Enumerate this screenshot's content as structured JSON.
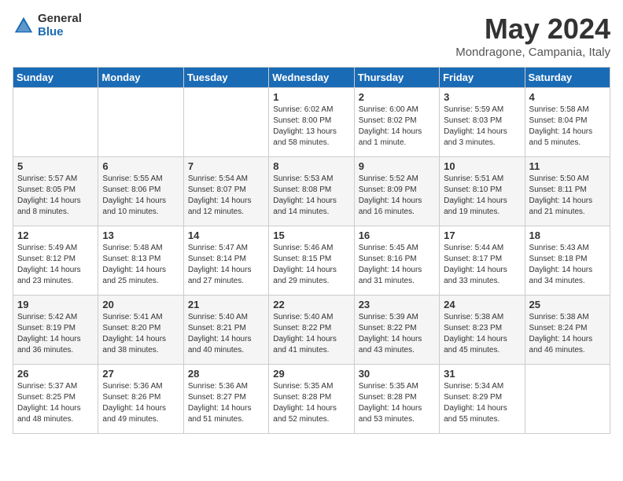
{
  "logo": {
    "general": "General",
    "blue": "Blue"
  },
  "title": "May 2024",
  "subtitle": "Mondragone, Campania, Italy",
  "days_of_week": [
    "Sunday",
    "Monday",
    "Tuesday",
    "Wednesday",
    "Thursday",
    "Friday",
    "Saturday"
  ],
  "weeks": [
    [
      {
        "day": "",
        "info": ""
      },
      {
        "day": "",
        "info": ""
      },
      {
        "day": "",
        "info": ""
      },
      {
        "day": "1",
        "info": "Sunrise: 6:02 AM\nSunset: 8:00 PM\nDaylight: 13 hours\nand 58 minutes."
      },
      {
        "day": "2",
        "info": "Sunrise: 6:00 AM\nSunset: 8:02 PM\nDaylight: 14 hours\nand 1 minute."
      },
      {
        "day": "3",
        "info": "Sunrise: 5:59 AM\nSunset: 8:03 PM\nDaylight: 14 hours\nand 3 minutes."
      },
      {
        "day": "4",
        "info": "Sunrise: 5:58 AM\nSunset: 8:04 PM\nDaylight: 14 hours\nand 5 minutes."
      }
    ],
    [
      {
        "day": "5",
        "info": "Sunrise: 5:57 AM\nSunset: 8:05 PM\nDaylight: 14 hours\nand 8 minutes."
      },
      {
        "day": "6",
        "info": "Sunrise: 5:55 AM\nSunset: 8:06 PM\nDaylight: 14 hours\nand 10 minutes."
      },
      {
        "day": "7",
        "info": "Sunrise: 5:54 AM\nSunset: 8:07 PM\nDaylight: 14 hours\nand 12 minutes."
      },
      {
        "day": "8",
        "info": "Sunrise: 5:53 AM\nSunset: 8:08 PM\nDaylight: 14 hours\nand 14 minutes."
      },
      {
        "day": "9",
        "info": "Sunrise: 5:52 AM\nSunset: 8:09 PM\nDaylight: 14 hours\nand 16 minutes."
      },
      {
        "day": "10",
        "info": "Sunrise: 5:51 AM\nSunset: 8:10 PM\nDaylight: 14 hours\nand 19 minutes."
      },
      {
        "day": "11",
        "info": "Sunrise: 5:50 AM\nSunset: 8:11 PM\nDaylight: 14 hours\nand 21 minutes."
      }
    ],
    [
      {
        "day": "12",
        "info": "Sunrise: 5:49 AM\nSunset: 8:12 PM\nDaylight: 14 hours\nand 23 minutes."
      },
      {
        "day": "13",
        "info": "Sunrise: 5:48 AM\nSunset: 8:13 PM\nDaylight: 14 hours\nand 25 minutes."
      },
      {
        "day": "14",
        "info": "Sunrise: 5:47 AM\nSunset: 8:14 PM\nDaylight: 14 hours\nand 27 minutes."
      },
      {
        "day": "15",
        "info": "Sunrise: 5:46 AM\nSunset: 8:15 PM\nDaylight: 14 hours\nand 29 minutes."
      },
      {
        "day": "16",
        "info": "Sunrise: 5:45 AM\nSunset: 8:16 PM\nDaylight: 14 hours\nand 31 minutes."
      },
      {
        "day": "17",
        "info": "Sunrise: 5:44 AM\nSunset: 8:17 PM\nDaylight: 14 hours\nand 33 minutes."
      },
      {
        "day": "18",
        "info": "Sunrise: 5:43 AM\nSunset: 8:18 PM\nDaylight: 14 hours\nand 34 minutes."
      }
    ],
    [
      {
        "day": "19",
        "info": "Sunrise: 5:42 AM\nSunset: 8:19 PM\nDaylight: 14 hours\nand 36 minutes."
      },
      {
        "day": "20",
        "info": "Sunrise: 5:41 AM\nSunset: 8:20 PM\nDaylight: 14 hours\nand 38 minutes."
      },
      {
        "day": "21",
        "info": "Sunrise: 5:40 AM\nSunset: 8:21 PM\nDaylight: 14 hours\nand 40 minutes."
      },
      {
        "day": "22",
        "info": "Sunrise: 5:40 AM\nSunset: 8:22 PM\nDaylight: 14 hours\nand 41 minutes."
      },
      {
        "day": "23",
        "info": "Sunrise: 5:39 AM\nSunset: 8:22 PM\nDaylight: 14 hours\nand 43 minutes."
      },
      {
        "day": "24",
        "info": "Sunrise: 5:38 AM\nSunset: 8:23 PM\nDaylight: 14 hours\nand 45 minutes."
      },
      {
        "day": "25",
        "info": "Sunrise: 5:38 AM\nSunset: 8:24 PM\nDaylight: 14 hours\nand 46 minutes."
      }
    ],
    [
      {
        "day": "26",
        "info": "Sunrise: 5:37 AM\nSunset: 8:25 PM\nDaylight: 14 hours\nand 48 minutes."
      },
      {
        "day": "27",
        "info": "Sunrise: 5:36 AM\nSunset: 8:26 PM\nDaylight: 14 hours\nand 49 minutes."
      },
      {
        "day": "28",
        "info": "Sunrise: 5:36 AM\nSunset: 8:27 PM\nDaylight: 14 hours\nand 51 minutes."
      },
      {
        "day": "29",
        "info": "Sunrise: 5:35 AM\nSunset: 8:28 PM\nDaylight: 14 hours\nand 52 minutes."
      },
      {
        "day": "30",
        "info": "Sunrise: 5:35 AM\nSunset: 8:28 PM\nDaylight: 14 hours\nand 53 minutes."
      },
      {
        "day": "31",
        "info": "Sunrise: 5:34 AM\nSunset: 8:29 PM\nDaylight: 14 hours\nand 55 minutes."
      },
      {
        "day": "",
        "info": ""
      }
    ]
  ]
}
